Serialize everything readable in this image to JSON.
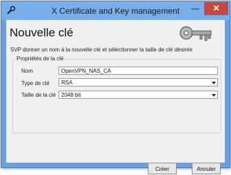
{
  "window": {
    "title": "X Certificate and Key management",
    "minimize_glyph": "—",
    "close_glyph": "✕",
    "icon": "tool-icon"
  },
  "page": {
    "title": "Nouvelle clé",
    "subtitle": "SVP donner un nom à la nouvelle clé et sélectionner la taille de clé désirée",
    "header_art": "key-icon"
  },
  "group": {
    "title": "Propriétés de la clé",
    "name_label": "Nom",
    "name_value": "OpenVPN_NAS_CA",
    "type_label": "Type de clé",
    "type_value": "RSA",
    "size_label": "Taille de la clé",
    "size_value": "2048 bit"
  },
  "buttons": {
    "create": "Créer",
    "cancel": "Annuler"
  },
  "colors": {
    "titlebar": "#78aee9",
    "close": "#c9483b"
  }
}
